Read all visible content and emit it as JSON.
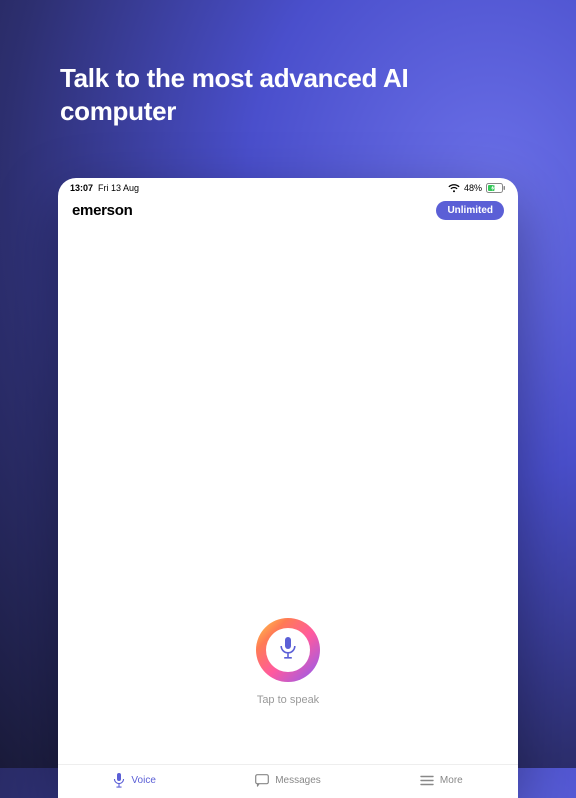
{
  "headline": "Talk to the most advanced AI computer",
  "statusBar": {
    "time": "13:07",
    "date": "Fri 13 Aug",
    "battery": "48%"
  },
  "header": {
    "title": "emerson",
    "badge": "Unlimited"
  },
  "mic": {
    "hint": "Tap to speak"
  },
  "tabs": {
    "voice": "Voice",
    "messages": "Messages",
    "more": "More"
  }
}
